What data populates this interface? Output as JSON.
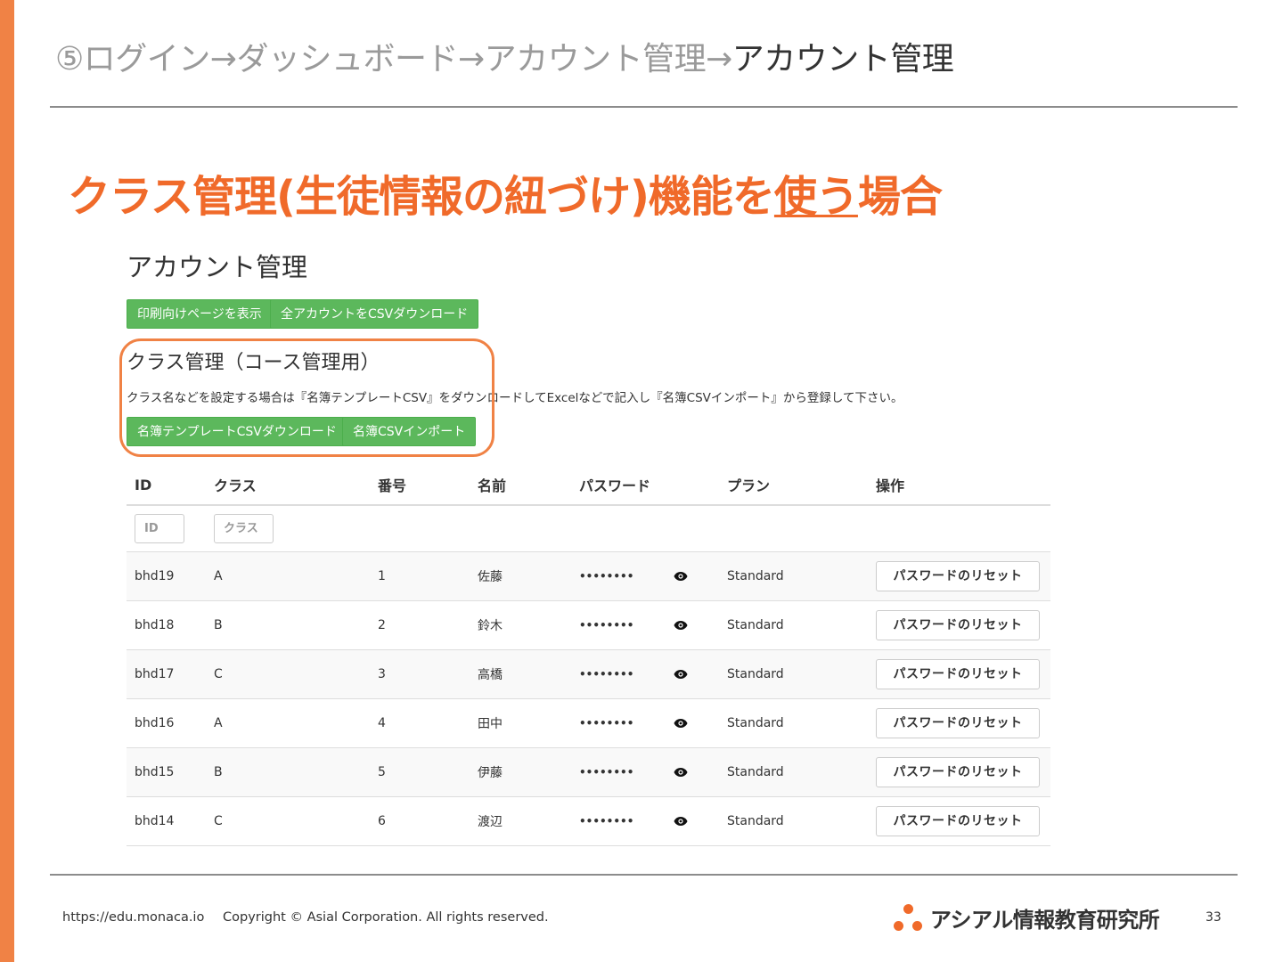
{
  "slide": {
    "breadcrumb": {
      "path": "⑤ログイン→ダッシュボード→アカウント管理→",
      "current": "アカウント管理"
    },
    "headline": {
      "before": "クラス管理(生徒情報の紐づけ)機能を",
      "underlined": "使う",
      "after": "場合"
    },
    "footer": {
      "url": "https://edu.monaca.io",
      "copyright": "Copyright © Asial Corporation. All rights reserved.",
      "logo_text": "アシアル情報教育研究所",
      "page_number": "33"
    },
    "accent_color": "#f08245"
  },
  "app": {
    "title": "アカウント管理",
    "buttons": {
      "print": "印刷向けページを表示",
      "download_all": "全アカウントをCSVダウンロード"
    },
    "class_section": {
      "title": "クラス管理（コース管理用）",
      "description": "クラス名などを設定する場合は『名簿テンプレートCSV』をダウンロードしてExcelなどで記入し『名簿CSVインポート』から登録して下さい。",
      "template_download": "名簿テンプレートCSVダウンロード",
      "csv_import": "名簿CSVインポート"
    },
    "table": {
      "headers": [
        "ID",
        "クラス",
        "番号",
        "名前",
        "パスワード",
        "プラン",
        "操作"
      ],
      "filters": {
        "id_placeholder": "ID",
        "class_placeholder": "クラス"
      },
      "rows": [
        {
          "id": "bhd19",
          "class": "A",
          "number": "1",
          "name": "佐藤",
          "password": "••••••••",
          "plan": "Standard",
          "action": "パスワードのリセット"
        },
        {
          "id": "bhd18",
          "class": "B",
          "number": "2",
          "name": "鈴木",
          "password": "••••••••",
          "plan": "Standard",
          "action": "パスワードのリセット"
        },
        {
          "id": "bhd17",
          "class": "C",
          "number": "3",
          "name": "高橋",
          "password": "••••••••",
          "plan": "Standard",
          "action": "パスワードのリセット"
        },
        {
          "id": "bhd16",
          "class": "A",
          "number": "4",
          "name": "田中",
          "password": "••••••••",
          "plan": "Standard",
          "action": "パスワードのリセット"
        },
        {
          "id": "bhd15",
          "class": "B",
          "number": "5",
          "name": "伊藤",
          "password": "••••••••",
          "plan": "Standard",
          "action": "パスワードのリセット"
        },
        {
          "id": "bhd14",
          "class": "C",
          "number": "6",
          "name": "渡辺",
          "password": "••••••••",
          "plan": "Standard",
          "action": "パスワードのリセット"
        }
      ]
    },
    "button_color": "#5cb85c"
  }
}
